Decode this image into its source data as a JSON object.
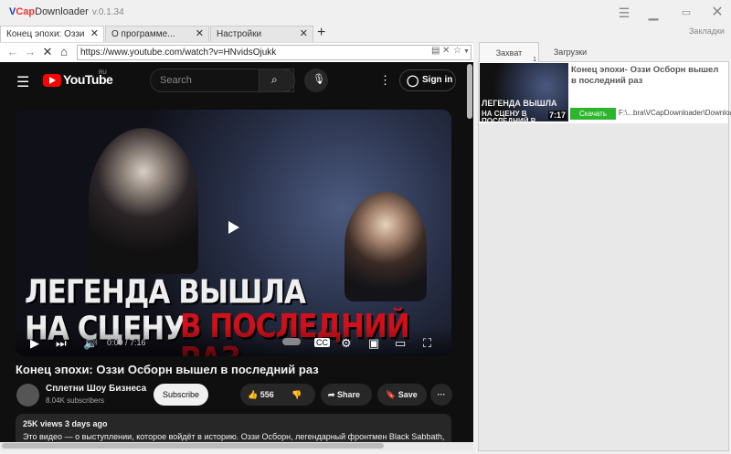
{
  "app": {
    "logo_v": "V",
    "logo_cap": "Cap",
    "logo_rest": "Downloader",
    "version": "v.0.1.34"
  },
  "window": {
    "menu_icon": "hamburger-icon",
    "minimize_icon": "minimize-icon",
    "maximize_icon": "maximize-icon",
    "close_icon": "close-icon"
  },
  "tabs": [
    {
      "label": "Конец эпохи: Оззи Осбо..."
    },
    {
      "label": "О программе..."
    },
    {
      "label": "Настройки"
    }
  ],
  "address": {
    "url": "https://www.youtube.com/watch?v=HNvidsOjukk"
  },
  "youtube": {
    "logo": "YouTube",
    "region": "RU",
    "search_placeholder": "Search",
    "sign_in": "Sign in",
    "thumb_line1": "ЛЕГЕНДА ВЫШЛА",
    "thumb_line2": "НА СЦЕНУ",
    "thumb_line3": "В ПОСЛЕДНИЙ РАЗ",
    "time": "0:00 / 7:16",
    "title": "Конец эпохи: Оззи Осборн вышел в последний раз",
    "channel": "Сплетни Шоу Бизнеса",
    "subscribers": "8.04K subscribers",
    "subscribe": "Subscribe",
    "likes": "556",
    "share": "Share",
    "save": "Save",
    "meta": "25K views  3 days ago",
    "description": "Это видео — о выступлении, которое войдёт в историю. Оззи Осборн, легендарный фронтмен Black Sabbath,"
  },
  "right": {
    "bookmarks": "Закладки",
    "tabs": [
      {
        "label": "Захват",
        "badge": "1"
      },
      {
        "label": "Загрузки"
      }
    ],
    "item": {
      "title": "Конец эпохи- Оззи Осборн вышел в последний раз",
      "duration": "7:17",
      "download": "Скачать",
      "path": "F:\\...bra\\VCapDownloader\\Downloads",
      "thumb1": "ЛЕГЕНДА ВЫШЛА",
      "thumb2": "НА СЦЕНУ В ПОСЛЕДНИЙ Р"
    }
  },
  "colors": {
    "accent": "#2db52d",
    "yt_red": "#ff0000",
    "thumb_red": "#d0101a"
  }
}
